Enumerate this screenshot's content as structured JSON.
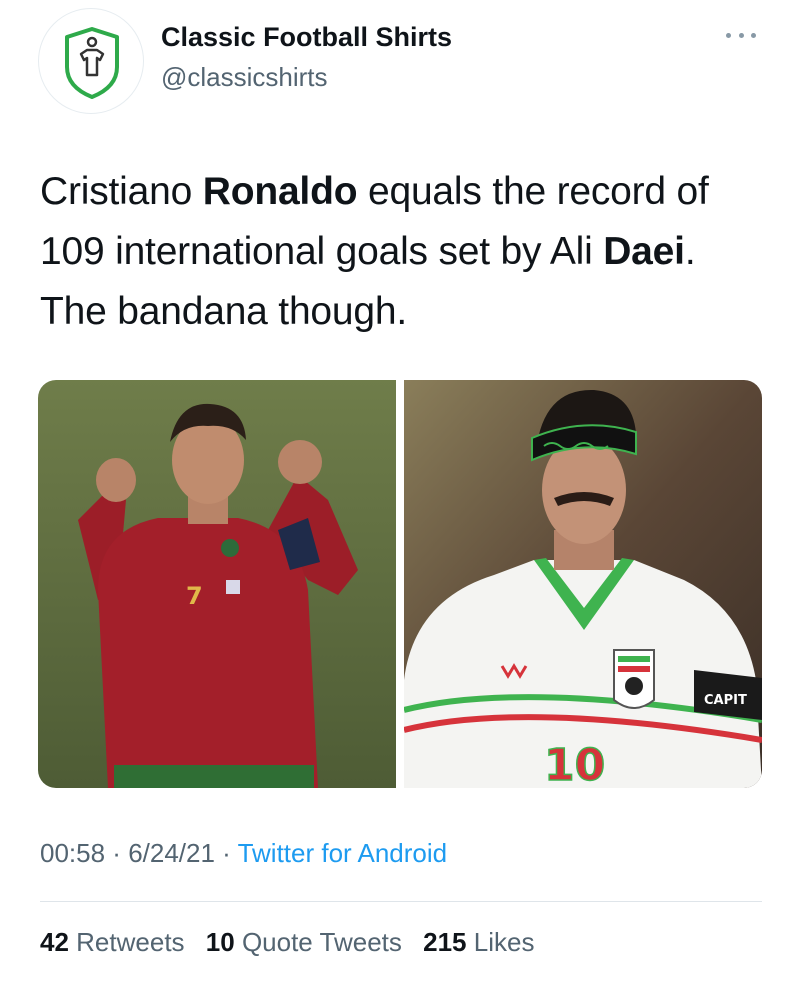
{
  "profile": {
    "display_name": "Classic Football Shirts",
    "handle": "@classicshirts",
    "avatar_icon": "shirt-shield-logo-icon",
    "accent_color": "#2eaa4a"
  },
  "menu": {
    "icon": "more-options-icon"
  },
  "tweet": {
    "text_part1": "Cristiano ",
    "text_bold1": "Ronaldo",
    "text_part2": " equals the record of 109 international goals set by Ali ",
    "text_bold2": "Daei",
    "text_part3": ". The bandana though."
  },
  "media": {
    "images": [
      {
        "name": "photo-ronaldo",
        "shirt_number": "7",
        "shirt_color": "#a31f2a"
      },
      {
        "name": "photo-daei",
        "shirt_number": "10",
        "armband_text": "CAPIT",
        "bandana_color": "#3fb34f"
      }
    ]
  },
  "meta": {
    "time": "00:58",
    "separator": " · ",
    "date": "6/24/21",
    "source": "Twitter for Android"
  },
  "stats": {
    "retweets_count": "42",
    "retweets_label": "Retweets",
    "quotes_count": "10",
    "quotes_label": "Quote Tweets",
    "likes_count": "215",
    "likes_label": "Likes"
  },
  "colors": {
    "link": "#1d9bf0",
    "secondary_text": "#536471",
    "primary_text": "#0f1419"
  }
}
